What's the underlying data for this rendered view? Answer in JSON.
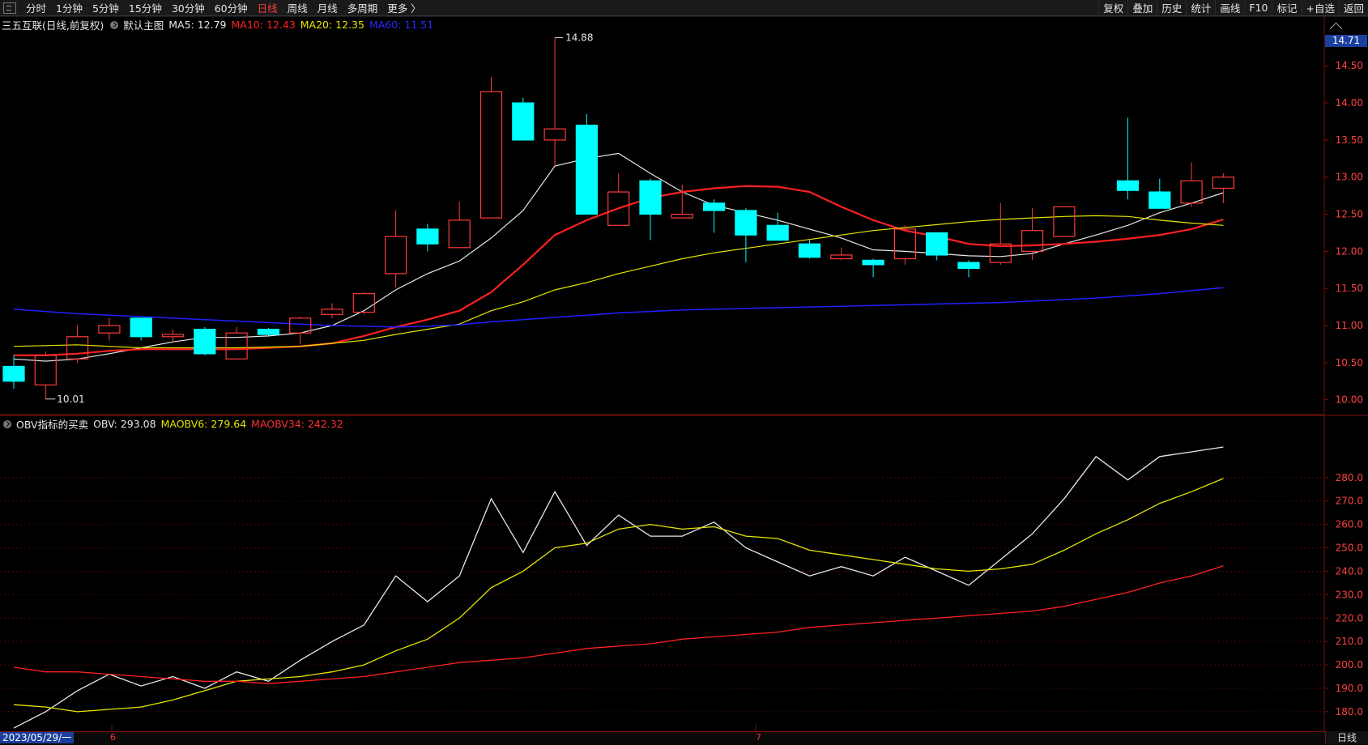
{
  "toolbar": {
    "left_items": [
      "分时",
      "1分钟",
      "5分钟",
      "15分钟",
      "30分钟",
      "60分钟",
      "日线",
      "周线",
      "月线",
      "多周期",
      "更多 〉"
    ],
    "active": "日线",
    "right_items": [
      "复权",
      "叠加",
      "历史",
      "统计",
      "画线",
      "F10",
      "标记",
      "+自选",
      "返回"
    ]
  },
  "main_info": {
    "stock": "三五互联(日线,前复权)",
    "template": "默认主图",
    "ma5": "MA5: 12.79",
    "ma10": "MA10: 12.43",
    "ma20": "MA20: 12.35",
    "ma60": "MA60: 11.51"
  },
  "sub_info": {
    "name": "OBV指标的买卖",
    "obv": "OBV: 293.08",
    "maobv6": "MAOBV6: 279.64",
    "maobv34": "MAOBV34: 242.32"
  },
  "current_price": "14.71",
  "high_label": "14.88",
  "low_label": "10.01",
  "date_label": "2023/05/29/一",
  "month_labels": [
    "6",
    "7"
  ],
  "period": "日线",
  "colors": {
    "up": "#ff3b3b",
    "down": "#00ffff",
    "ma5": "#e8e8e8",
    "ma10": "#ff2020",
    "ma20": "#e6e600",
    "ma60": "#2020ff",
    "obv": "#e8e8e8",
    "maobv6": "#e6e600",
    "maobv34": "#ff2020",
    "grid": "#7a1010",
    "axis_text": "#ff4040"
  },
  "chart_data": [
    {
      "type": "candlestick",
      "title": "三五互联(日线,前复权)",
      "y_ticks": [
        10.0,
        10.5,
        11.0,
        11.5,
        12.0,
        12.5,
        13.0,
        13.5,
        14.0,
        14.5
      ],
      "ylim": [
        9.8,
        14.95
      ],
      "candles": [
        {
          "o": 10.45,
          "h": 10.6,
          "l": 10.15,
          "c": 10.25
        },
        {
          "o": 10.2,
          "h": 10.65,
          "l": 10.01,
          "c": 10.6
        },
        {
          "o": 10.55,
          "h": 11.0,
          "l": 10.5,
          "c": 10.85
        },
        {
          "o": 10.9,
          "h": 11.1,
          "l": 10.8,
          "c": 11.0
        },
        {
          "o": 11.1,
          "h": 11.1,
          "l": 10.8,
          "c": 10.85
        },
        {
          "o": 10.85,
          "h": 10.95,
          "l": 10.78,
          "c": 10.88
        },
        {
          "o": 10.95,
          "h": 10.98,
          "l": 10.6,
          "c": 10.62
        },
        {
          "o": 10.55,
          "h": 10.98,
          "l": 10.55,
          "c": 10.9
        },
        {
          "o": 10.95,
          "h": 10.97,
          "l": 10.85,
          "c": 10.88
        },
        {
          "o": 10.9,
          "h": 11.12,
          "l": 10.75,
          "c": 11.1
        },
        {
          "o": 11.15,
          "h": 11.3,
          "l": 11.1,
          "c": 11.22
        },
        {
          "o": 11.18,
          "h": 11.45,
          "l": 11.15,
          "c": 11.43
        },
        {
          "o": 11.7,
          "h": 12.55,
          "l": 11.52,
          "c": 12.2
        },
        {
          "o": 12.3,
          "h": 12.37,
          "l": 12.0,
          "c": 12.1
        },
        {
          "o": 12.05,
          "h": 12.67,
          "l": 12.05,
          "c": 12.42
        },
        {
          "o": 12.45,
          "h": 14.35,
          "l": 12.45,
          "c": 14.15
        },
        {
          "o": 14.0,
          "h": 14.07,
          "l": 13.5,
          "c": 13.5
        },
        {
          "o": 13.5,
          "h": 14.88,
          "l": 13.15,
          "c": 13.65
        },
        {
          "o": 13.7,
          "h": 13.85,
          "l": 12.5,
          "c": 12.5
        },
        {
          "o": 12.35,
          "h": 13.05,
          "l": 12.35,
          "c": 12.8
        },
        {
          "o": 12.95,
          "h": 12.98,
          "l": 12.15,
          "c": 12.5
        },
        {
          "o": 12.45,
          "h": 12.9,
          "l": 12.45,
          "c": 12.5
        },
        {
          "o": 12.65,
          "h": 12.7,
          "l": 12.25,
          "c": 12.55
        },
        {
          "o": 12.55,
          "h": 12.58,
          "l": 11.85,
          "c": 12.22
        },
        {
          "o": 12.35,
          "h": 12.52,
          "l": 12.15,
          "c": 12.15
        },
        {
          "o": 12.1,
          "h": 12.15,
          "l": 11.9,
          "c": 11.92
        },
        {
          "o": 11.9,
          "h": 12.05,
          "l": 11.88,
          "c": 11.95
        },
        {
          "o": 11.88,
          "h": 11.9,
          "l": 11.65,
          "c": 11.82
        },
        {
          "o": 11.9,
          "h": 12.35,
          "l": 11.82,
          "c": 12.3
        },
        {
          "o": 12.25,
          "h": 12.25,
          "l": 11.88,
          "c": 11.95
        },
        {
          "o": 11.85,
          "h": 11.88,
          "l": 11.65,
          "c": 11.77
        },
        {
          "o": 11.85,
          "h": 12.65,
          "l": 11.82,
          "c": 12.1
        },
        {
          "o": 12.0,
          "h": 12.58,
          "l": 11.88,
          "c": 12.28
        },
        {
          "o": 12.2,
          "h": 12.6,
          "l": 12.2,
          "c": 12.6
        },
        {
          "o": null,
          "h": null,
          "l": null,
          "c": null
        },
        {
          "o": 12.95,
          "h": 13.8,
          "l": 12.7,
          "c": 12.82
        },
        {
          "o": 12.8,
          "h": 12.98,
          "l": 12.6,
          "c": 12.58
        },
        {
          "o": 12.65,
          "h": 13.2,
          "l": 12.6,
          "c": 12.95
        },
        {
          "o": 12.85,
          "h": 13.05,
          "l": 12.65,
          "c": 13.0
        }
      ],
      "series": [
        {
          "name": "MA5",
          "values": [
            10.55,
            10.52,
            10.55,
            10.62,
            10.7,
            10.78,
            10.84,
            10.84,
            10.86,
            10.9,
            11.0,
            11.2,
            11.48,
            11.7,
            11.87,
            12.18,
            12.55,
            13.15,
            13.25,
            13.32,
            13.05,
            12.8,
            12.62,
            12.52,
            12.42,
            12.3,
            12.18,
            12.02,
            12.0,
            11.97,
            11.94,
            11.93,
            11.97,
            12.1,
            12.22,
            12.35,
            12.52,
            12.65,
            12.79
          ]
        },
        {
          "name": "MA10",
          "values": [
            10.6,
            10.6,
            10.62,
            10.66,
            10.68,
            10.68,
            10.68,
            10.68,
            10.7,
            10.72,
            10.76,
            10.86,
            10.98,
            11.08,
            11.2,
            11.45,
            11.82,
            12.22,
            12.42,
            12.58,
            12.72,
            12.8,
            12.85,
            12.88,
            12.87,
            12.8,
            12.6,
            12.42,
            12.28,
            12.2,
            12.1,
            12.07,
            12.08,
            12.1,
            12.13,
            12.17,
            12.22,
            12.3,
            12.43
          ]
        },
        {
          "name": "MA20",
          "values": [
            10.72,
            10.73,
            10.74,
            10.72,
            10.7,
            10.7,
            10.7,
            10.7,
            10.71,
            10.72,
            10.76,
            10.8,
            10.88,
            10.95,
            11.02,
            11.2,
            11.32,
            11.48,
            11.58,
            11.7,
            11.8,
            11.9,
            11.98,
            12.04,
            12.1,
            12.16,
            12.22,
            12.28,
            12.32,
            12.36,
            12.4,
            12.43,
            12.45,
            12.47,
            12.48,
            12.47,
            12.42,
            12.38,
            12.35
          ]
        },
        {
          "name": "MA60",
          "values": [
            11.22,
            11.19,
            11.16,
            11.14,
            11.12,
            11.1,
            11.08,
            11.06,
            11.04,
            11.02,
            11.0,
            10.99,
            10.98,
            10.99,
            11.01,
            11.05,
            11.08,
            11.11,
            11.14,
            11.17,
            11.19,
            11.21,
            11.22,
            11.23,
            11.24,
            11.25,
            11.26,
            11.27,
            11.28,
            11.29,
            11.3,
            11.31,
            11.33,
            11.35,
            11.37,
            11.4,
            11.43,
            11.47,
            11.51
          ]
        }
      ]
    },
    {
      "type": "line",
      "title": "OBV指标的买卖",
      "y_ticks": [
        180,
        190,
        200,
        210,
        220,
        230,
        240,
        250,
        260,
        270,
        280
      ],
      "ylim": [
        172,
        300
      ],
      "series": [
        {
          "name": "OBV",
          "values": [
            173,
            180,
            189,
            196,
            191,
            195,
            190,
            197,
            193,
            202,
            210,
            217,
            238,
            227,
            238,
            271,
            248,
            274,
            251,
            264,
            255,
            255,
            261,
            250,
            244,
            238,
            242,
            238,
            246,
            240,
            234,
            245,
            256,
            271,
            289,
            279,
            289,
            291,
            293.08
          ]
        },
        {
          "name": "MAOBV6",
          "values": [
            183,
            182,
            180,
            181,
            182,
            185,
            189,
            193,
            194,
            195,
            197,
            200,
            206,
            211,
            220,
            233,
            240,
            250,
            252,
            258,
            260,
            258,
            259,
            255,
            254,
            249,
            247,
            245,
            243,
            241,
            240,
            241,
            243,
            249,
            256,
            262,
            269,
            274,
            279.64
          ]
        },
        {
          "name": "MAOBV34",
          "values": [
            199,
            197,
            197,
            196,
            195,
            194,
            193,
            193,
            192,
            193,
            194,
            195,
            197,
            199,
            201,
            202,
            203,
            205,
            207,
            208,
            209,
            211,
            212,
            213,
            214,
            216,
            217,
            218,
            219,
            220,
            221,
            222,
            223,
            225,
            228,
            231,
            235,
            238,
            242.32
          ]
        }
      ]
    }
  ]
}
